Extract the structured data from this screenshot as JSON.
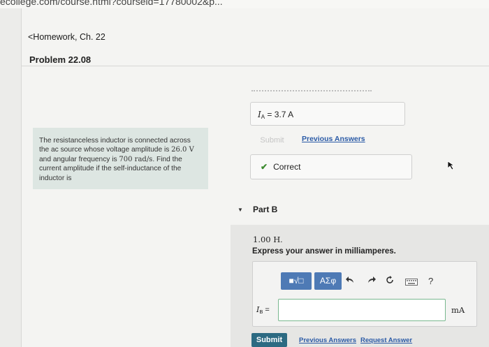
{
  "browser": {
    "url": "ecollege.com/course.html?courseid=17780002&p..."
  },
  "nav": {
    "back_link": "<Homework, Ch. 22"
  },
  "problem": {
    "title": "Problem 22.08",
    "text_1": "The resistanceless inductor is connected across the ac source whose voltage amplitude is ",
    "voltage": "26.0 V",
    "text_2": " and angular frequency is ",
    "frequency": "700 rad/s",
    "text_3": ". Find the current amplitude if the self-inductance of the inductor is"
  },
  "part_a": {
    "answer_var": "I",
    "answer_sub": "A",
    "answer_value": " = 3.7  A",
    "submit_label": "Submit",
    "previous_answers": "Previous Answers",
    "status": "Correct"
  },
  "part_b": {
    "title": "Part B",
    "inductance": "1.00 H",
    "inductance_suffix": ".",
    "instruction": "Express your answer in milliamperes.",
    "toolbar": {
      "templates_label": "■√□",
      "symbols_label": "ΑΣφ",
      "icons": [
        "undo-icon",
        "redo-icon",
        "reset-icon",
        "keyboard-icon",
        "help-icon"
      ],
      "help_label": "?"
    },
    "input_var": "I",
    "input_sub": "B",
    "input_eq": " =",
    "input_value": "",
    "unit": "mA",
    "submit_label": "Submit",
    "previous_answers": "Previous Answers",
    "request_answer": "Request Answer"
  },
  "colors": {
    "submit_bg": "#2c6a82",
    "link": "#2a5aa6",
    "toolbar_bg": "#4e7ab5",
    "correct_check": "#3c8a2e",
    "problem_bg": "#dde6e2"
  }
}
